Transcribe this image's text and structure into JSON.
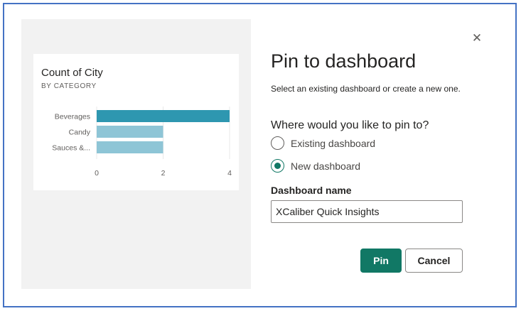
{
  "dialog": {
    "title": "Pin to dashboard",
    "description": "Select an existing dashboard or create a new one.",
    "question": "Where would you like to pin to?",
    "options": [
      {
        "label": "Existing dashboard",
        "selected": false
      },
      {
        "label": "New dashboard",
        "selected": true
      }
    ],
    "dashboard_name_label": "Dashboard name",
    "dashboard_name_value": "XCaliber Quick Insights",
    "pin_label": "Pin",
    "cancel_label": "Cancel",
    "close_icon": "close-icon"
  },
  "tile": {
    "title": "Count of City",
    "subtitle": "BY CATEGORY"
  },
  "chart_data": {
    "type": "bar",
    "orientation": "horizontal",
    "categories": [
      "Beverages",
      "Candy",
      "Sauces &..."
    ],
    "values": [
      4,
      2,
      2
    ],
    "xlim": [
      0,
      4
    ],
    "xticks": [
      "0",
      "2",
      "4"
    ],
    "colors": {
      "highlight": "#2e97b0",
      "default": "#8ec5d6"
    }
  },
  "colors": {
    "accent": "#117865",
    "border": "#4472c4"
  }
}
